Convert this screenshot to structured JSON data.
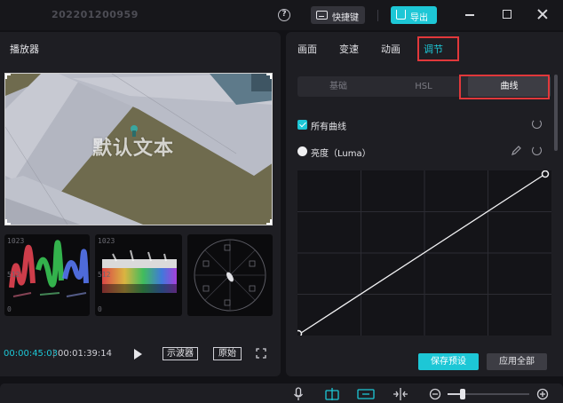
{
  "titlebar": {
    "project_title": "202201200959",
    "help_symbol": "?",
    "shortcut_label": "快捷键",
    "export_label": "导出"
  },
  "player": {
    "title": "播放器",
    "overlay_text": "默认文本",
    "scope_labels": {
      "top": "1023",
      "mid": "512",
      "bottom": "0"
    },
    "time_current": "00:00:45:03",
    "time_sep": "|",
    "time_total": "00:01:39:14",
    "oscilloscope_label": "示波器",
    "original_label": "原始"
  },
  "adjust": {
    "tabs": [
      "画面",
      "变速",
      "动画",
      "调节"
    ],
    "active_tab": "调节",
    "subtabs": [
      "基础",
      "HSL",
      "曲线"
    ],
    "active_subtab": "曲线",
    "all_curves_label": "所有曲线",
    "luma_label": "亮度（Luma）",
    "save_preset_label": "保存预设",
    "apply_all_label": "应用全部"
  },
  "colors": {
    "accent": "#1dc7d6",
    "highlight": "#e1383b",
    "panel": "#1e1e23",
    "background": "#121216"
  },
  "icons": [
    "help-icon",
    "keyboard-icon",
    "export-icon",
    "minimize-icon",
    "maximize-icon",
    "close-icon",
    "play-icon",
    "fullscreen-icon",
    "reset-icon",
    "eyedropper-icon",
    "microphone-icon",
    "magnet-icon",
    "link-icon",
    "split-icon",
    "zoom-out-icon",
    "zoom-in-icon"
  ]
}
